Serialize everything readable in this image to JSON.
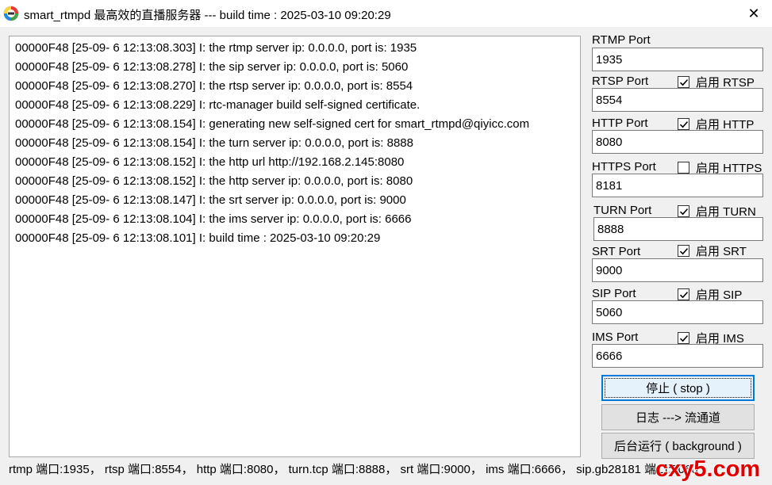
{
  "window": {
    "title": "smart_rtmpd 最高效的直播服务器 --- build time : 2025-03-10 09:20:29",
    "icon": "app-logo-icon",
    "close_glyph": "✕"
  },
  "log": [
    "00000F48 [25-09- 6 12:13:08.303] I: the rtmp server ip: 0.0.0.0, port is: 1935",
    "00000F48 [25-09- 6 12:13:08.278] I: the sip server ip: 0.0.0.0, port is: 5060",
    "00000F48 [25-09- 6 12:13:08.270] I: the rtsp server ip: 0.0.0.0, port is: 8554",
    "00000F48 [25-09- 6 12:13:08.229] I: rtc-manager build self-signed certificate.",
    "00000F48 [25-09- 6 12:13:08.154] I: generating new self-signed cert for smart_rtmpd@qiyicc.com",
    "00000F48 [25-09- 6 12:13:08.154] I: the turn server ip: 0.0.0.0, port is: 8888",
    "00000F48 [25-09- 6 12:13:08.152] I: the http url http://192.168.2.145:8080",
    "00000F48 [25-09- 6 12:13:08.152] I: the http server ip: 0.0.0.0, port is: 8080",
    "00000F48 [25-09- 6 12:13:08.147] I: the srt server ip: 0.0.0.0, port is: 9000",
    "00000F48 [25-09- 6 12:13:08.104] I: the ims server ip: 0.0.0.0, port is: 6666",
    "00000F48 [25-09- 6 12:13:08.101] I: build time : 2025-03-10 09:20:29"
  ],
  "ports": {
    "rtmp": {
      "label": "RTMP Port",
      "value": "1935"
    },
    "rtsp": {
      "label": "RTSP Port",
      "value": "8554",
      "enable_label": "启用 RTSP",
      "enabled": true
    },
    "http": {
      "label": "HTTP Port",
      "value": "8080",
      "enable_label": "启用 HTTP",
      "enabled": true
    },
    "https": {
      "label": "HTTPS Port",
      "value": "8181",
      "enable_label": "启用 HTTPS",
      "enabled": false
    },
    "turn": {
      "label": "TURN Port",
      "value": "8888",
      "enable_label": "启用 TURN",
      "enabled": true
    },
    "srt": {
      "label": "SRT Port",
      "value": "9000",
      "enable_label": "启用 SRT",
      "enabled": true
    },
    "sip": {
      "label": "SIP Port",
      "value": "5060",
      "enable_label": "启用 SIP",
      "enabled": true
    },
    "ims": {
      "label": "IMS Port",
      "value": "6666",
      "enable_label": "启用 IMS",
      "enabled": true
    }
  },
  "buttons": {
    "stop": "停止 ( stop )",
    "log_toggle": "日志 ---> 流通道",
    "background": "后台运行 ( background )"
  },
  "status_bar": "rtmp 端口:1935， rtsp 端口:8554， http 端口:8080， turn.tcp 端口:8888， srt 端口:9000， ims 端口:6666， sip.gb28181 端口:5060",
  "watermark": "cxy5.com",
  "colors": {
    "accent": "#0078d7",
    "watermark": "#e00000",
    "window_bg": "#f0f0f0"
  }
}
